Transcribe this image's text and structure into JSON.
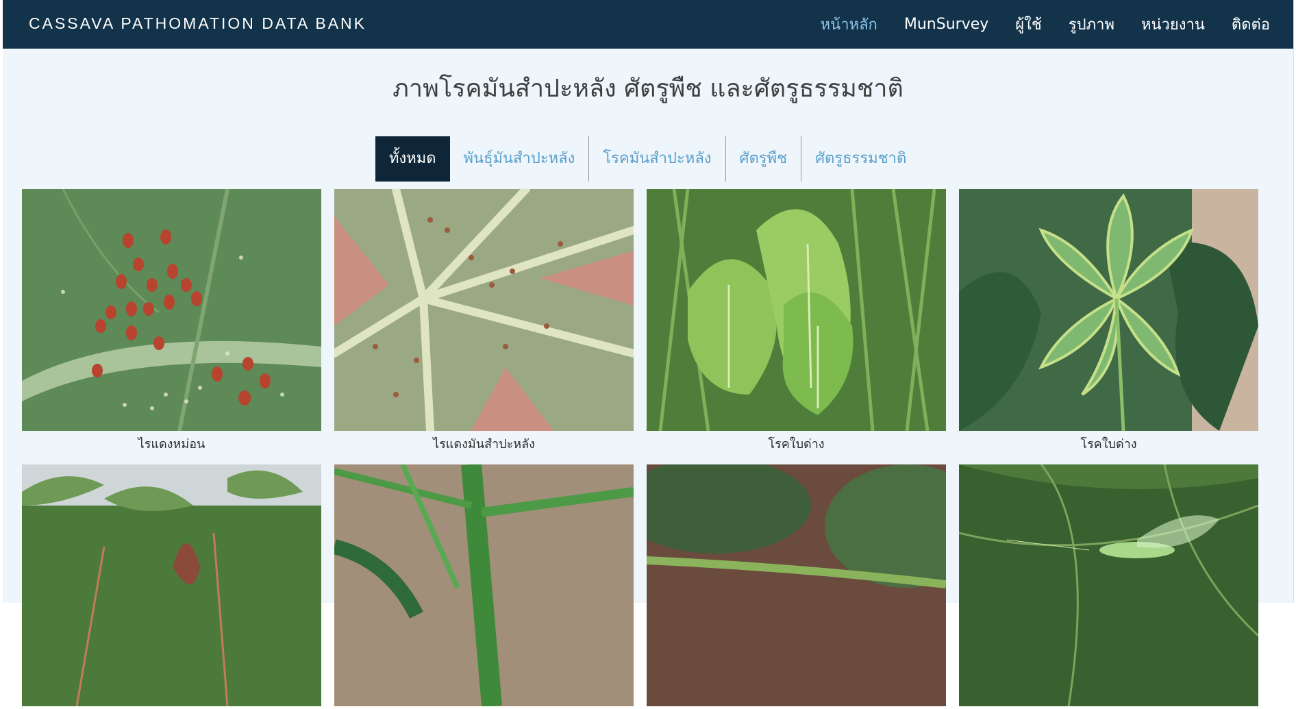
{
  "brand": "CASSAVA PATHOMATION DATA BANK",
  "nav": [
    "หน้าหลัก",
    "MunSurvey",
    "ผู้ใช้",
    "รูปภาพ",
    "หน่วยงาน",
    "ติดต่อ"
  ],
  "page_title": "ภาพโรคมันสำปะหลัง ศัตรูพืช และศัตรูธรรมชาติ",
  "filters": [
    "ทั้งหมด",
    "พันธุ์มันสำปะหลัง",
    "โรคมันสำปะหลัง",
    "ศัตรูพืช",
    "ศัตรูธรรมชาติ"
  ],
  "gallery": [
    {
      "caption": "ไรแดงหม่อน"
    },
    {
      "caption": "ไรแดงมันสำปะหลัง"
    },
    {
      "caption": "โรคใบด่าง"
    },
    {
      "caption": "โรคใบด่าง"
    },
    {
      "caption": ""
    },
    {
      "caption": ""
    },
    {
      "caption": ""
    },
    {
      "caption": ""
    }
  ],
  "colors": {
    "navbar": "#12334a",
    "nav_active": "#8ec3e6",
    "filter_active_bg": "#0e2638",
    "filter_text": "#5a9fc9",
    "page_bg": "#eef6fc"
  }
}
